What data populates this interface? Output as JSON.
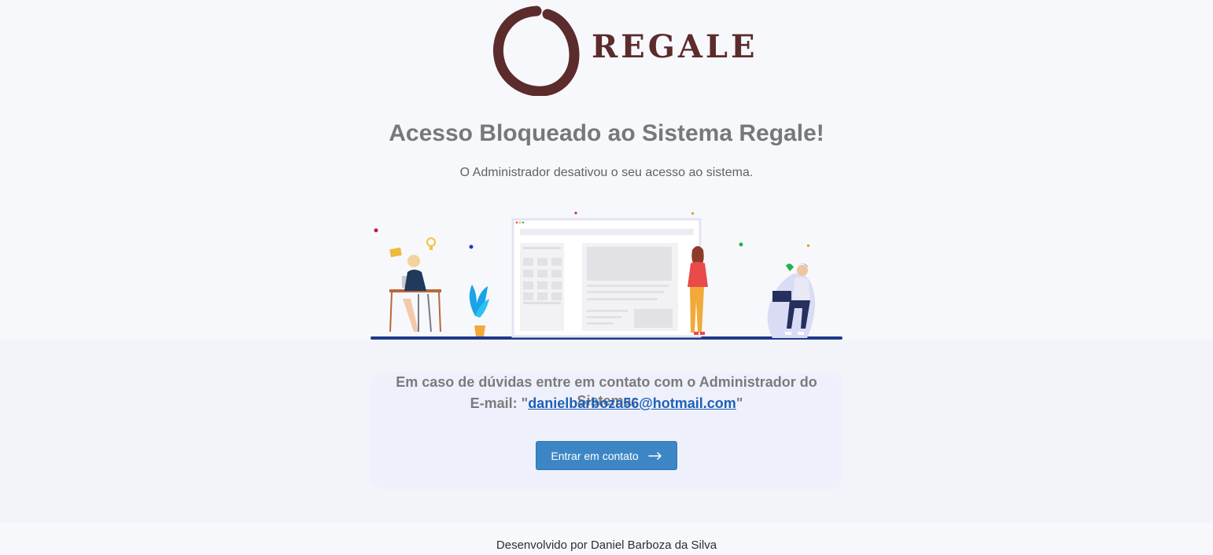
{
  "brand": {
    "name": "REGALE",
    "color": "#5c2b2c"
  },
  "page": {
    "title": "Acesso Bloqueado ao Sistema Regale!",
    "subtitle": "O Administrador desativou o seu acesso ao sistema."
  },
  "contact": {
    "message": "Em caso de dúvidas entre em contato com o Administrador do Sistema:",
    "email_prefix": "E-mail: \"",
    "email": "danielbarboza56@hotmail.com",
    "email_suffix": "\"",
    "button_label": "Entrar em contato",
    "button_icon": "arrow-right-icon",
    "accent": "#3d86c6"
  },
  "footer": {
    "credit": "Desenvolvido por Daniel Barboza da Silva"
  }
}
